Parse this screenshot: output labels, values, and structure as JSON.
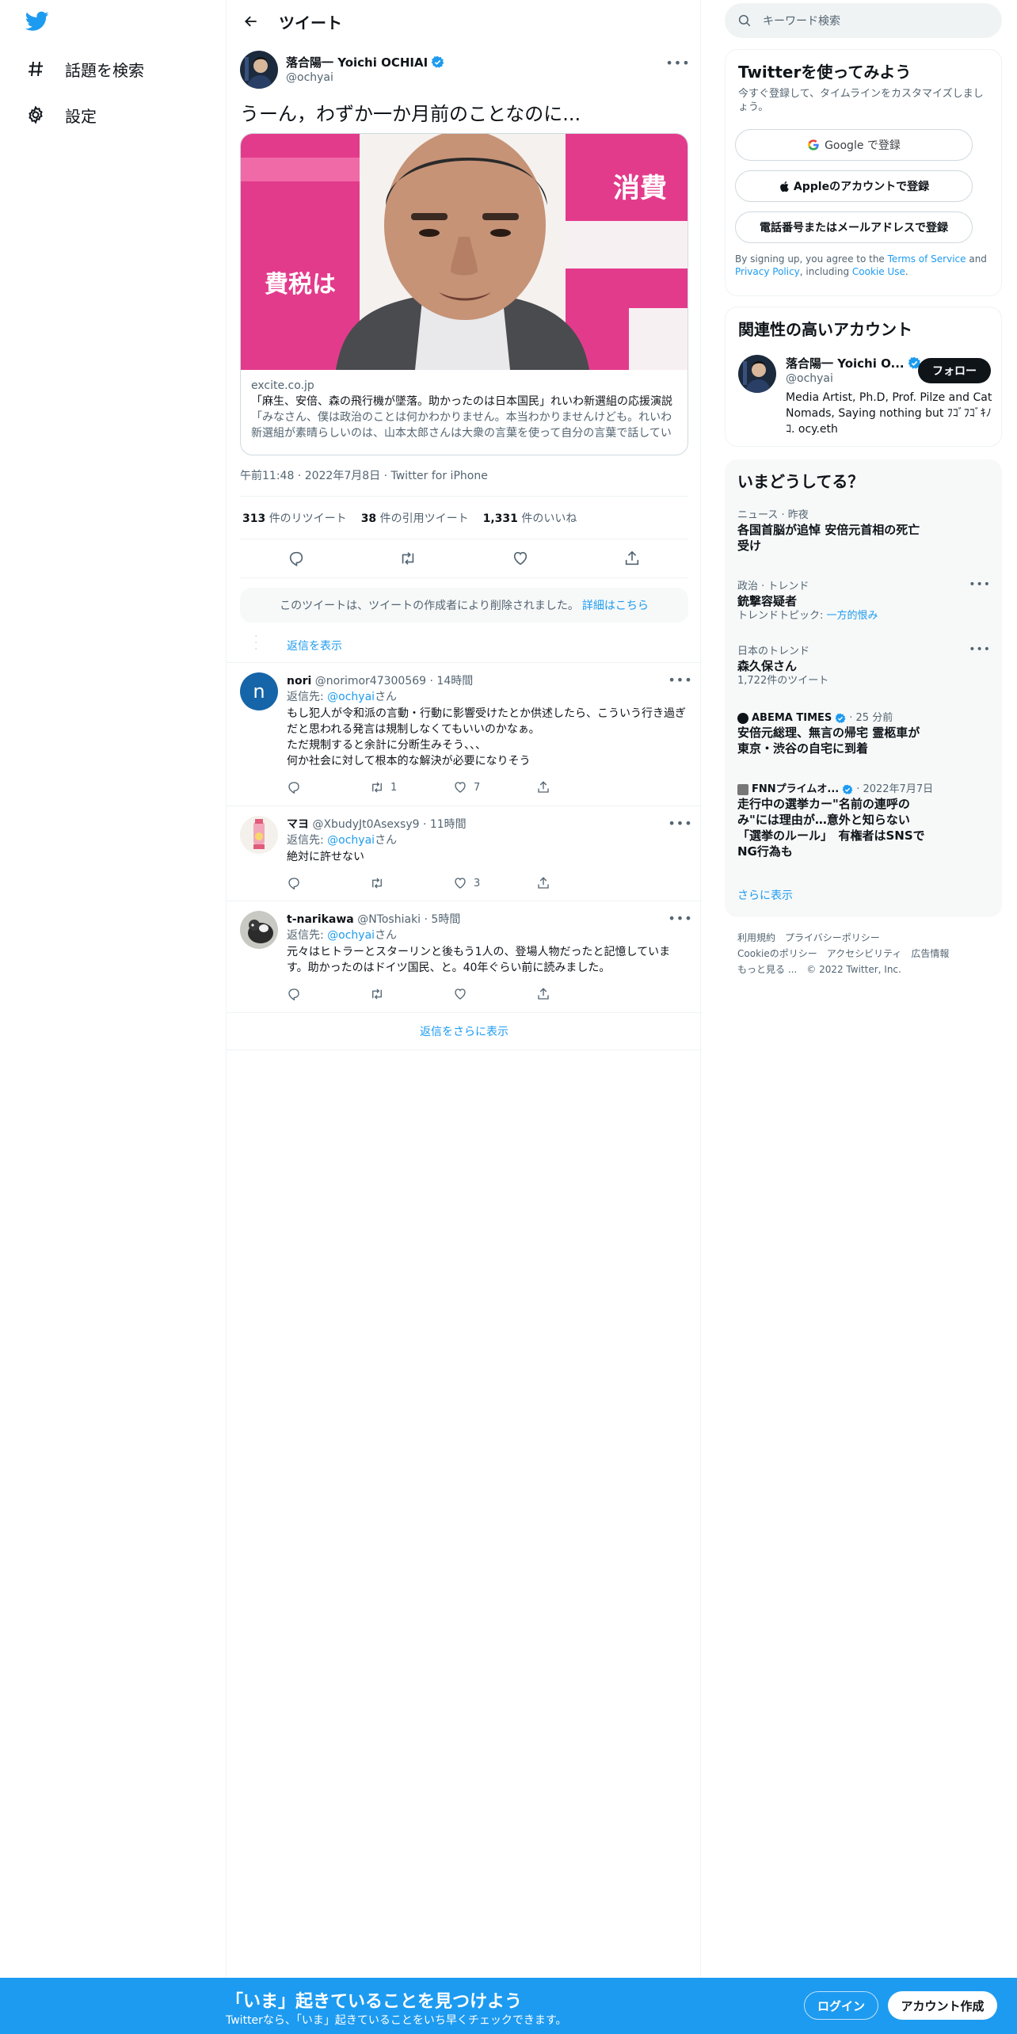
{
  "nav": {
    "explore_label": "話題を検索",
    "settings_label": "設定"
  },
  "header": {
    "title": "ツイート"
  },
  "tweet": {
    "author_name": "落合陽一 Yoichi OCHIAI",
    "author_handle": "@ochyai",
    "text": "うーん，わずか一か月前のことなのに...",
    "card": {
      "domain": "excite.co.jp",
      "title": "「麻生、安倍、森の飛行機が墜落。助かったのは日本国民」れいわ新選組の応援演説",
      "description": "「みなさん、僕は政治のことは何かわかりません。本当わかりませんけども。れいわ新選組が素晴らしいのは、山本太郎さんは大衆の言葉を使って自分の言葉で話している"
    },
    "timestamp": "午前11:48 · 2022年7月8日 · Twitter for iPhone",
    "retweets_count": "313",
    "retweets_label": "件のリツイート",
    "quotes_count": "38",
    "quotes_label": "件の引用ツイート",
    "likes_count": "1,331",
    "likes_label": "件のいいね"
  },
  "deleted_notice": {
    "text": "このツイートは、ツイートの作成者により削除されました。",
    "link": "詳細はこちら"
  },
  "show_replies_label": "返信を表示",
  "replies": [
    {
      "name": "nori",
      "handle": "@norimor47300569",
      "time": "· 14時間",
      "avatar_letter": "n",
      "replying_prefix": "返信先: ",
      "replying_to": "@ochyai",
      "replying_suffix": "さん",
      "lines": [
        "もし犯人が令和派の言動・行動に影響受けたとか供述したら、こういう行き過ぎだと思われる発言は規制しなくてもいいのかなぁ。",
        "ただ規制すると余計に分断生みそう、、、",
        "何か社会に対して根本的な解決が必要になりそう"
      ],
      "retweets": "1",
      "likes": "7"
    },
    {
      "name": "マヨ",
      "handle": "@XbudyJt0Asexsy9",
      "time": "· 11時間",
      "replying_prefix": "返信先: ",
      "replying_to": "@ochyai",
      "replying_suffix": "さん",
      "lines": [
        "絶対に許せない"
      ],
      "retweets": "",
      "likes": "3"
    },
    {
      "name": "t-narikawa",
      "handle": "@NToshiaki",
      "time": "· 5時間",
      "replying_prefix": "返信先: ",
      "replying_to": "@ochyai",
      "replying_suffix": "さん",
      "lines": [
        "元々はヒトラーとスターリンと後もう1人の、登場人物だったと記憶しています。助かったのはドイツ国民、と。40年ぐらい前に読みました。"
      ],
      "retweets": "",
      "likes": ""
    }
  ],
  "more_replies_label": "返信をさらに表示",
  "search": {
    "placeholder": "キーワード検索"
  },
  "signup_panel": {
    "title": "Twitterを使ってみよう",
    "subtitle": "今すぐ登録して、タイムラインをカスタマイズしましょう。",
    "google_label": "Google で登録",
    "apple_label": "Appleのアカウントで登録",
    "phone_label": "電話番号またはメールアドレスで登録",
    "legal_prefix": "By signing up, you agree to the ",
    "terms": "Terms of Service",
    "and": " and ",
    "privacy": "Privacy Policy",
    "including": ", including ",
    "cookie": "Cookie Use",
    "period": "."
  },
  "related": {
    "title": "関連性の高いアカウント",
    "name": "落合陽一 Yoichi O...",
    "handle": "@ochyai",
    "follow_label": "フォロー",
    "bio": "Media Artist, Ph.D, Prof. Pilze and Cat Nomads, Saying nothing but ﾌｺﾞﾌｺﾞｷﾉｺ. ocy.eth"
  },
  "trends": {
    "title": "いまどうしてる？",
    "items": [
      {
        "context": "ニュース · 昨夜",
        "title": "各国首脳が追悼 安倍元首相の死亡受け"
      },
      {
        "context": "政治 · トレンド",
        "title": "銃撃容疑者",
        "sub_prefix": "トレンドトピック: ",
        "sub_link": "一方的恨み"
      },
      {
        "context": "日本のトレンド",
        "title": "森久保さん",
        "sub": "1,722件のツイート"
      },
      {
        "source": "ABEMA TIMES",
        "time": "· 25 分前",
        "title": "安倍元総理、無言の帰宅 霊柩車が東京・渋谷の自宅に到着"
      },
      {
        "source": "FNNプライムオ...",
        "time": "· 2022年7月7日",
        "title": "走行中の選挙カー\"名前の連呼のみ\"には理由が…意外と知らない「選挙のルール」　有権者はSNSでNG行為も"
      }
    ],
    "show_more": "さらに表示"
  },
  "footer": {
    "links": [
      "利用規約",
      "プライバシーポリシー",
      "Cookieのポリシー",
      "アクセシビリティ",
      "広告情報",
      "もっと見る ..."
    ],
    "copyright": "© 2022 Twitter, Inc."
  },
  "bottom_bar": {
    "headline": "「いま」起きていることを見つけよう",
    "sub": "Twitterなら、「いま」起きていることをいち早くチェックできます。",
    "login": "ログイン",
    "signup": "アカウント作成"
  },
  "colors": {
    "accent": "#1d9bf0",
    "text": "#0f1419",
    "muted": "#536471"
  }
}
